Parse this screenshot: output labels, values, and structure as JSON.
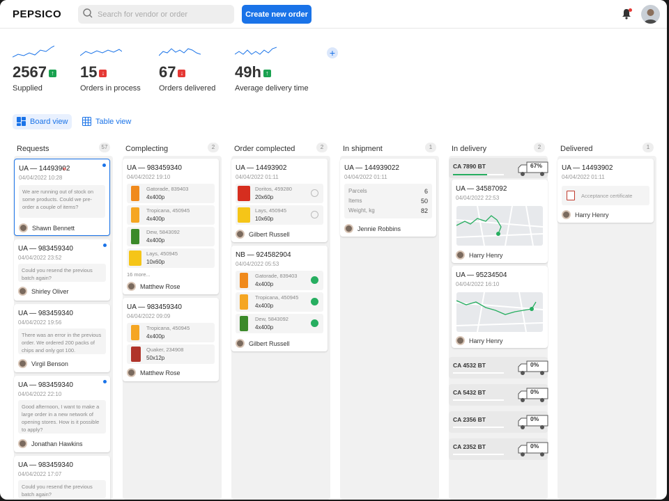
{
  "header": {
    "logo": "PEPSICO",
    "search_placeholder": "Search for vendor or order",
    "create_button": "Create new order"
  },
  "stats": [
    {
      "value": "2567",
      "trend": "up",
      "label": "Supplied"
    },
    {
      "value": "15",
      "trend": "down",
      "label": "Orders in process"
    },
    {
      "value": "67",
      "trend": "down",
      "label": "Orders delivered"
    },
    {
      "value": "49h",
      "trend": "up",
      "label": "Average delivery time"
    }
  ],
  "views": {
    "board": "Board view",
    "table": "Table view"
  },
  "columns": {
    "requests": {
      "title": "Requests",
      "count": "57"
    },
    "completing": {
      "title": "Complecting",
      "count": "2"
    },
    "completed": {
      "title": "Order complected",
      "count": "2"
    },
    "shipment": {
      "title": "In shipment",
      "count": "1"
    },
    "delivery": {
      "title": "In delivery",
      "count": "2"
    },
    "delivered": {
      "title": "Delivered",
      "count": "1"
    }
  },
  "requests": [
    {
      "id": "UA — 14493902",
      "date": "04/04/2022 10:28",
      "msg": "We are running out of stock on some products. Could we pre-order a couple of items?",
      "person": "Shawn Bennett"
    },
    {
      "id": "UA — 983459340",
      "date": "04/04/2022 23:52",
      "msg": "Could you resend the previous batch again?",
      "person": "Shirley Oliver"
    },
    {
      "id": "UA — 983459340",
      "date": "04/04/2022 19:56",
      "msg": "There was an error in the previous order. We ordered 200 packs of chips and only got 100.",
      "person": "Virgil Benson"
    },
    {
      "id": "UA — 983459340",
      "date": "04/04/2022 22:10",
      "msg": "Good afternoon, I want to make a large order in a new network of opening stores. How is it possible to apply?",
      "person": "Jonathan Hawkins"
    },
    {
      "id": "UA — 983459340",
      "date": "04/04/2022 17:07",
      "msg": "Could you resend the previous batch again?"
    }
  ],
  "completing": [
    {
      "id": "UA — 983459340",
      "date": "04/04/2022 19:10",
      "products": [
        {
          "name": "Gatorade, 839403",
          "qty": "4x400p"
        },
        {
          "name": "Tropicana, 450945",
          "qty": "4x400p"
        },
        {
          "name": "Dew, 5843092",
          "qty": "4x400p"
        },
        {
          "name": "Lays, 450945",
          "qty": "10x60p"
        }
      ],
      "more": "16 more...",
      "person": "Matthew Rose"
    },
    {
      "id": "UA — 983459340",
      "date": "04/04/2022 09:09",
      "products": [
        {
          "name": "Tropicana, 450945",
          "qty": "4x400p"
        },
        {
          "name": "Quaker, 234908",
          "qty": "50x12p"
        }
      ],
      "person": "Matthew Rose"
    }
  ],
  "completed": [
    {
      "id": "UA — 14493902",
      "date": "04/04/2022 01:11",
      "products": [
        {
          "name": "Doritos, 459280",
          "qty": "20x60p"
        },
        {
          "name": "Lays, 450945",
          "qty": "10x60p"
        }
      ],
      "person": "Gilbert Russell"
    },
    {
      "id": "NB — 924582904",
      "date": "04/04/2022 05:53",
      "products": [
        {
          "name": "Gatorade, 839403",
          "qty": "4x400p"
        },
        {
          "name": "Tropicana, 450945",
          "qty": "4x400p"
        },
        {
          "name": "Dew, 5843092",
          "qty": "4x400p"
        }
      ],
      "person": "Gilbert Russell"
    }
  ],
  "shipment": {
    "id": "UA — 144939022",
    "date": "04/04/2022 01:11",
    "parcels_label": "Parcels",
    "parcels": "6",
    "items_label": "Items",
    "items": "50",
    "weight_label": "Weight, kg",
    "weight": "82",
    "person": "Jennie Robbins"
  },
  "delivery": {
    "vehicle_main": {
      "code": "CA 7890 BT",
      "pct": "67%",
      "progress": 0.67
    },
    "orders": [
      {
        "id": "UA — 34587092",
        "date": "04/04/2022 22:53",
        "person": "Harry Henry"
      },
      {
        "id": "UA — 95234504",
        "date": "04/04/2022 16:10",
        "person": "Harry Henry"
      }
    ],
    "vehicles": [
      {
        "code": "CA 4532 BT",
        "pct": "0%"
      },
      {
        "code": "CA 5432 BT",
        "pct": "0%"
      },
      {
        "code": "CA 2356 BT",
        "pct": "0%"
      },
      {
        "code": "CA 2352 BT",
        "pct": "0%"
      }
    ]
  },
  "delivered": {
    "id": "UA — 14493902",
    "date": "04/04/2022 01:11",
    "doc": "Acceptance certificate",
    "person": "Harry Henry"
  },
  "colors": {
    "accent": "#1a73e8",
    "up": "#1aa250",
    "down": "#e53935",
    "done": "#27ae60"
  }
}
